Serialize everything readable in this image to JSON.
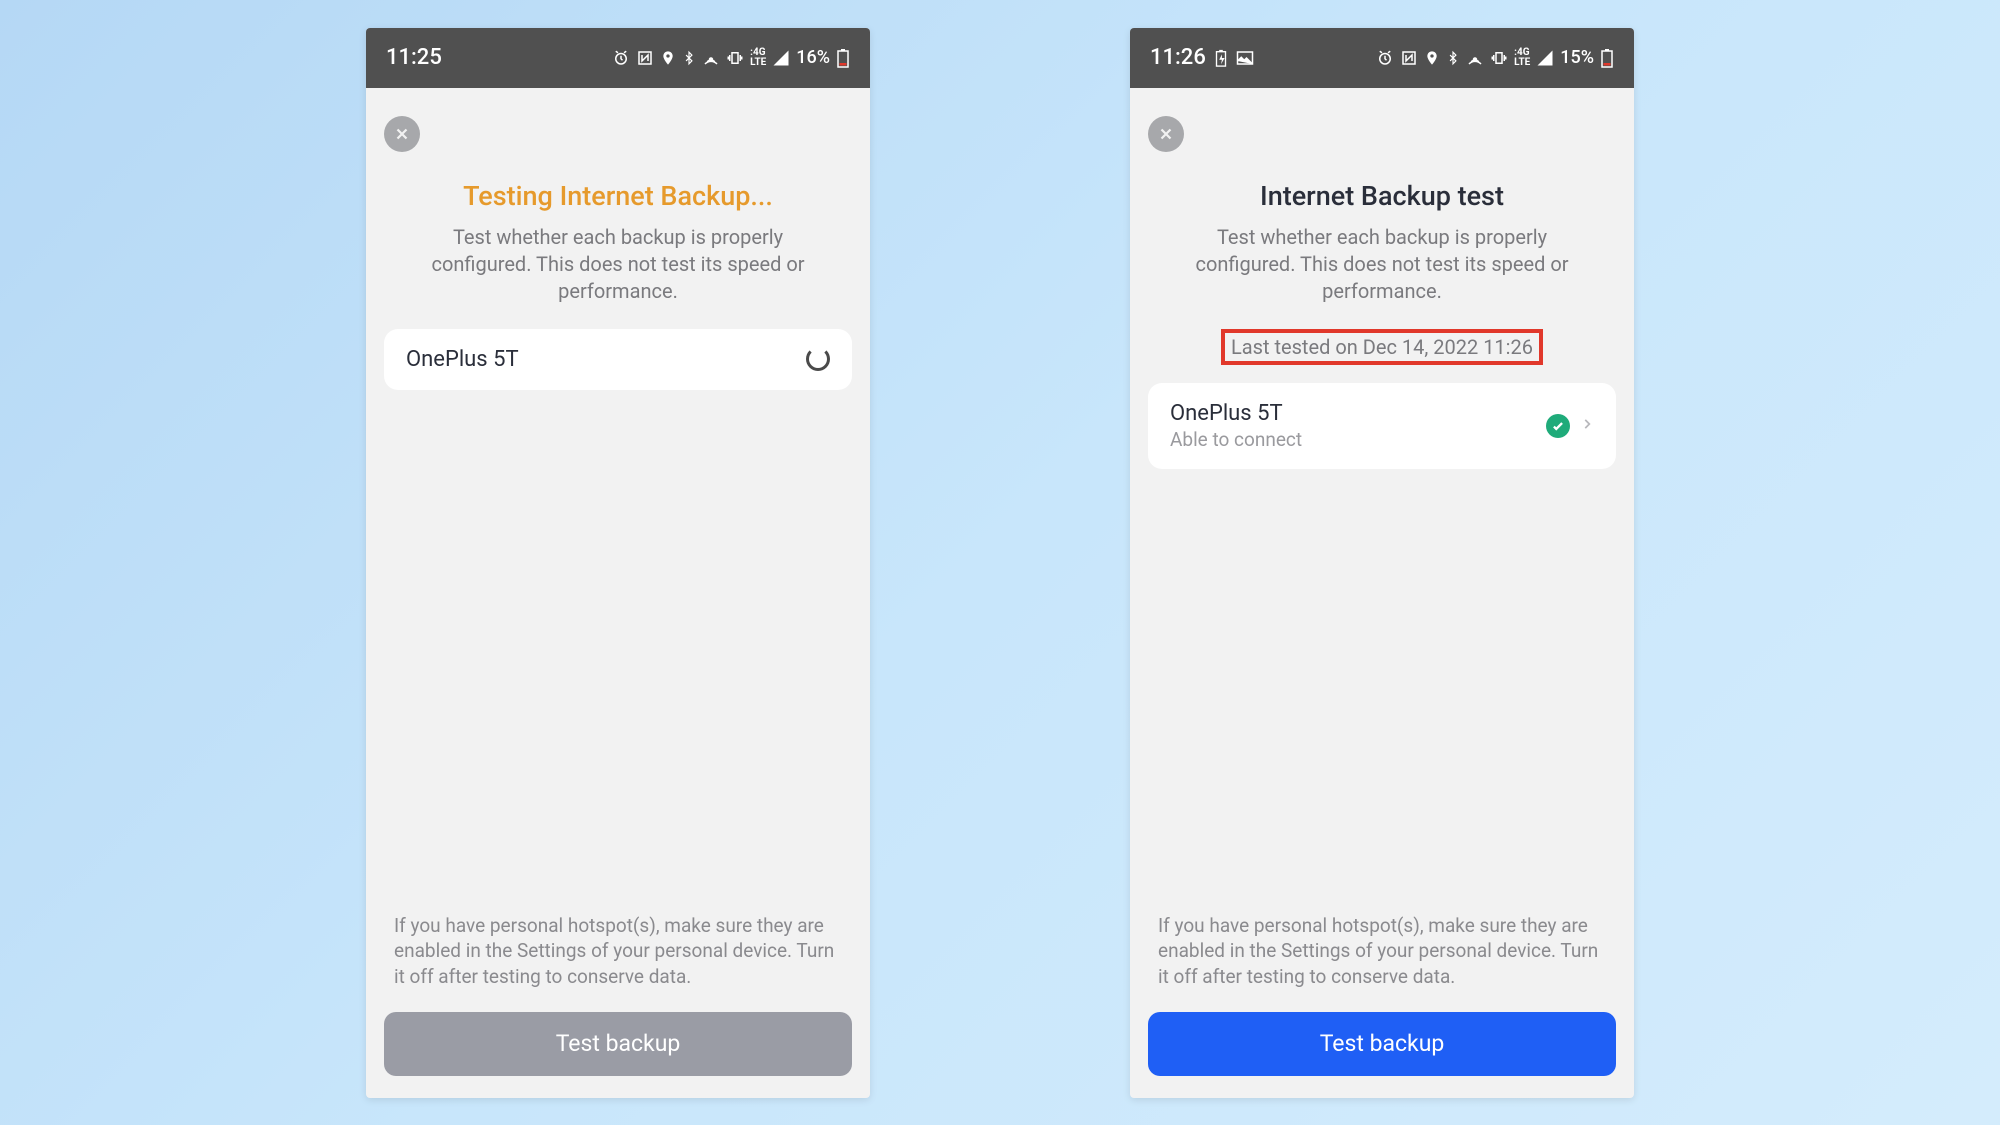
{
  "left": {
    "statusBar": {
      "time": "11:25",
      "battery": "16%"
    },
    "title": "Testing Internet Backup...",
    "subtitle": "Test whether each backup is properly configured. This does not test its speed or performance.",
    "card": {
      "title": "OnePlus 5T"
    },
    "footerNote": "If you have personal hotspot(s), make sure they are enabled in the Settings of your personal device. Turn it off after testing to conserve data.",
    "button": "Test backup"
  },
  "right": {
    "statusBar": {
      "time": "11:26",
      "battery": "15%"
    },
    "title": "Internet Backup test",
    "subtitle": "Test whether each backup is properly configured. This does not test its speed or performance.",
    "lastTested": "Last tested on Dec 14, 2022 11:26",
    "card": {
      "title": "OnePlus 5T",
      "sub": "Able to connect"
    },
    "footerNote": "If you have personal hotspot(s), make sure they are enabled in the Settings of your personal device. Turn it off after testing to conserve data.",
    "button": "Test backup"
  }
}
